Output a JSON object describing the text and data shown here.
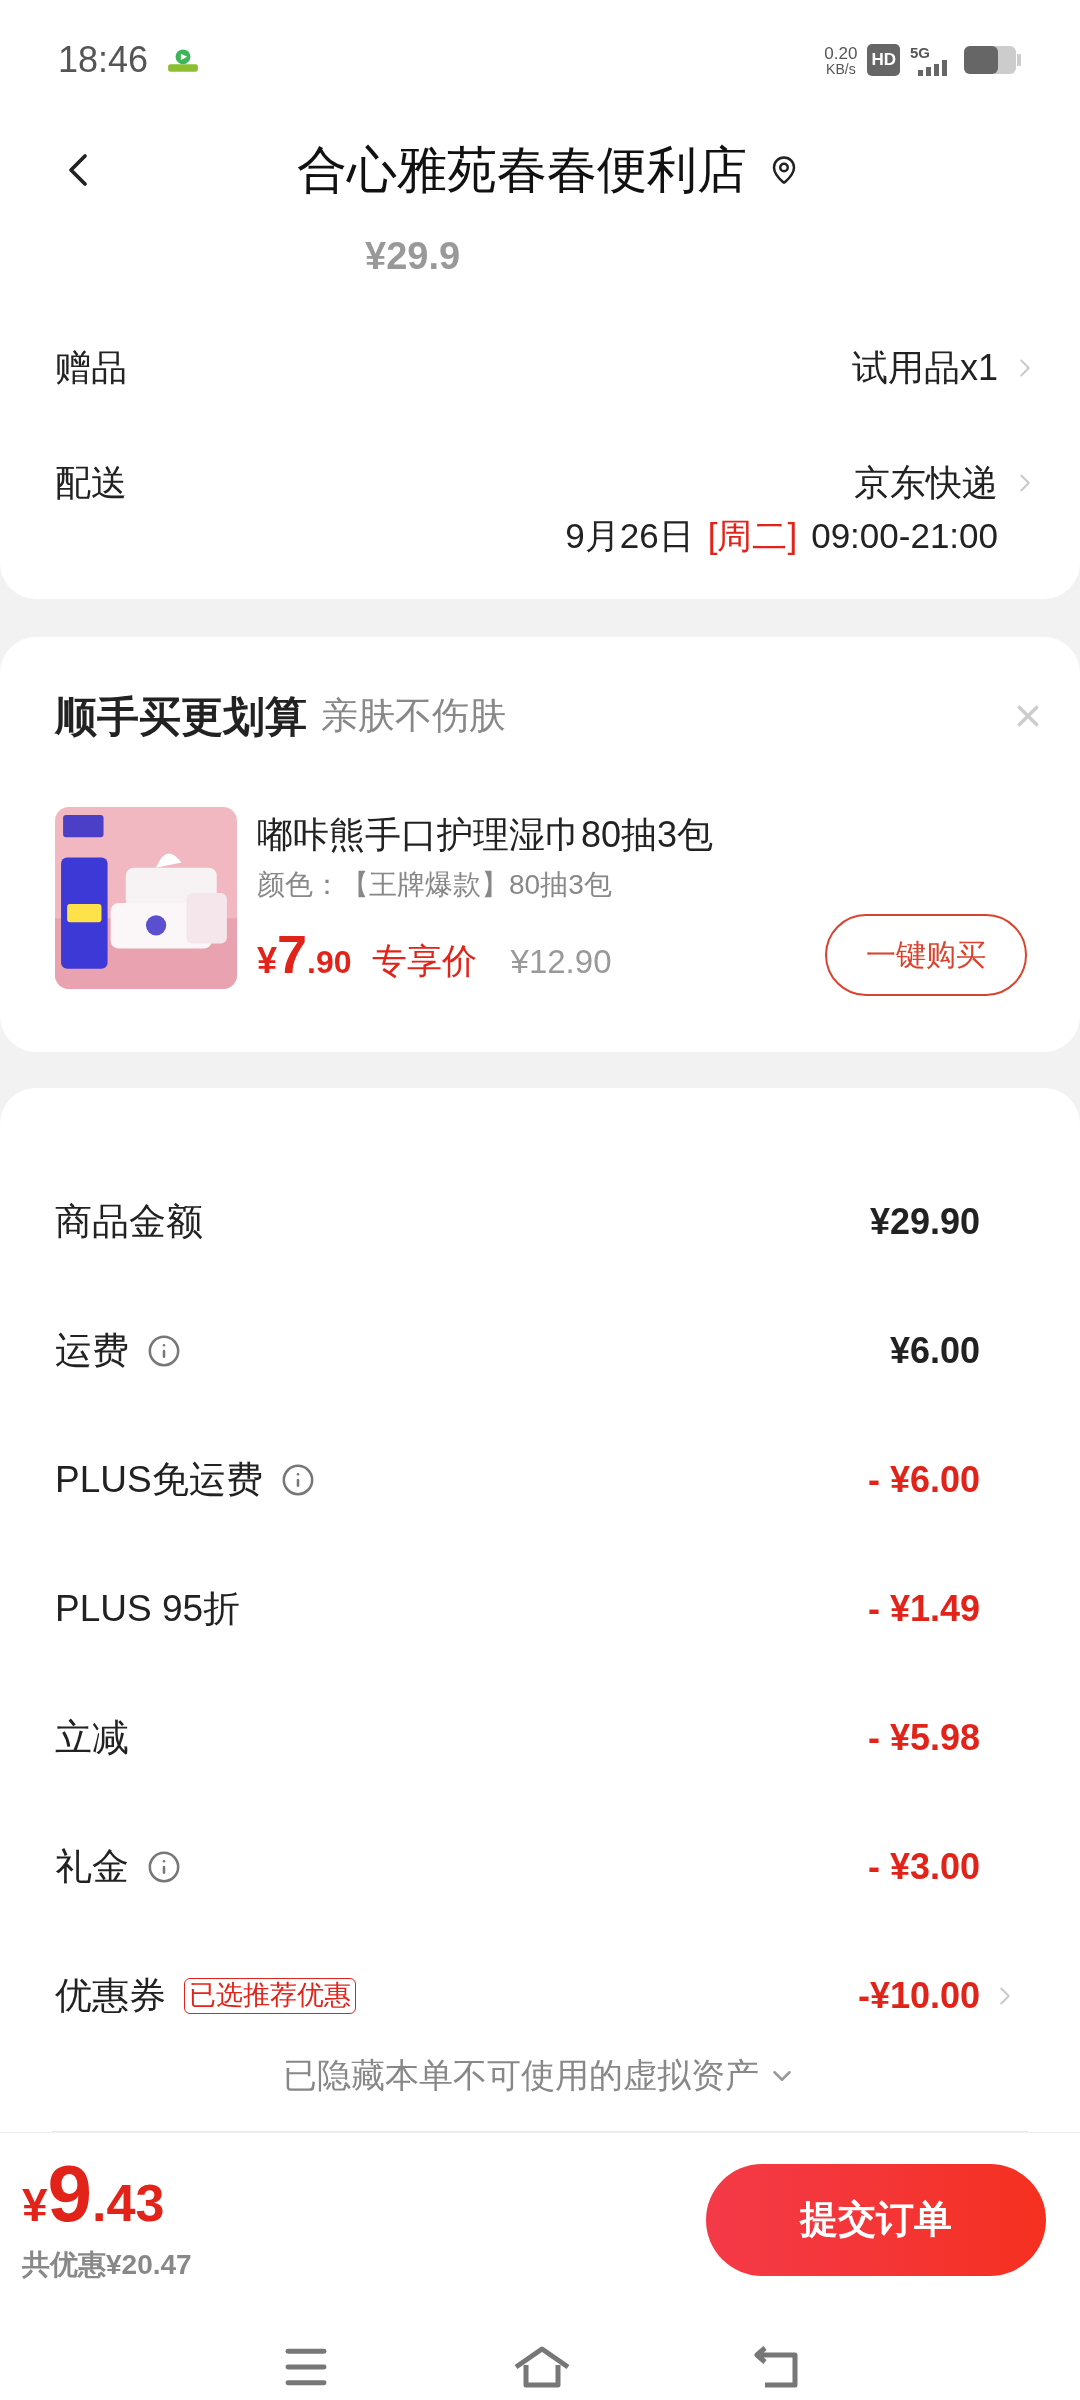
{
  "status_bar": {
    "time": "18:46",
    "speed": "0.20",
    "speed_unit": "KB/s",
    "hd": "HD",
    "network": "5G"
  },
  "header": {
    "title": "合心雅苑春春便利店"
  },
  "order": {
    "price": "¥29.9",
    "rows": [
      {
        "label": "赠品",
        "value": "试用品x1"
      },
      {
        "label": "配送",
        "value": "京东快递"
      }
    ],
    "delivery_time": {
      "date": "9月26日",
      "weekday": "[周二]",
      "hours": "09:00-21:00"
    }
  },
  "addon": {
    "title": "顺手买更划算",
    "subtitle": "亲肤不伤肤",
    "product": {
      "kind": "picture",
      "name": "嘟咔熊手口护理湿巾80抽3包",
      "spec": "颜色：【王牌爆款】80抽3包",
      "currency": "¥",
      "price_int": "7",
      "price_dec": ".90",
      "tag": "专享价",
      "original_price": "¥12.90"
    },
    "button": "一键购买"
  },
  "costs": [
    {
      "label": "商品金额",
      "value": "¥29.90",
      "kind": "amount",
      "info": false,
      "chevron": false
    },
    {
      "label": "运费",
      "value": "¥6.00",
      "kind": "amount",
      "info": true,
      "chevron": false
    },
    {
      "label": "PLUS免运费",
      "value": "- ¥6.00",
      "kind": "discount",
      "info": true,
      "chevron": false
    },
    {
      "label": "PLUS 95折",
      "value": "- ¥1.49",
      "kind": "discount",
      "info": false,
      "chevron": false
    },
    {
      "label": "立减",
      "value": "- ¥5.98",
      "kind": "discount",
      "info": false,
      "chevron": false
    },
    {
      "label": "礼金",
      "value": "- ¥3.00",
      "kind": "discount",
      "info": true,
      "chevron": false
    },
    {
      "label": "优惠券",
      "badge": "已选推荐优惠",
      "value": "-¥10.00",
      "kind": "discount",
      "info": false,
      "chevron": true
    }
  ],
  "hidden_note": "已隐藏本单不可使用的虚拟资产",
  "footer": {
    "currency": "¥",
    "total_int": "9",
    "total_dec": ".43",
    "savings": "共优惠¥20.47",
    "submit": "提交订单"
  }
}
